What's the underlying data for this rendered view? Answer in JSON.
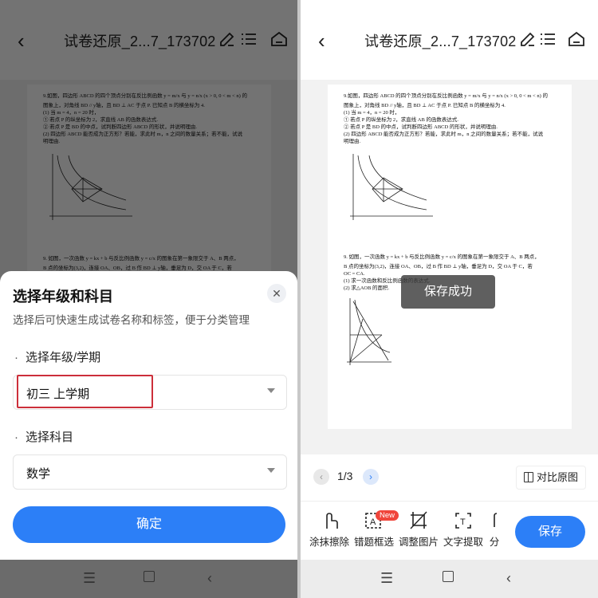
{
  "header": {
    "title": "试卷还原_2...7_173702",
    "back_icon": "chevron-left-icon",
    "edit_icon": "pencil-icon",
    "list_icon": "list-icon",
    "home_icon": "home-icon"
  },
  "paper": {
    "q9_line1": "9.如图，四边形 ABCD 的四个顶点分别在反比例函数 y = m/x 与 y = n/x (x > 0, 0 < m < n) 的",
    "q9_line2": "图象上，对角线 BD // y轴，且 BD ⊥ AC 于点 P. 已知点 B 的横坐标为 4.",
    "q9_line3": "(1) 当 m = 4，n = 20 时，",
    "q9_line4": "① 若点 P 的纵坐标为 2，求直线 AB 的函数表达式.",
    "q9_line5": "② 若点 P 是 BD 的中点，试判断四边形 ABCD 的形状，并说明理由.",
    "q9_line6": "(2) 四边形 ABCD 能否成为正方形？若能，求此时 m，n 之间的数量关系；若不能，试说",
    "q9_line7": "明理由.",
    "q9b_line1": "9.   如图，一次函数 y = kx + b 与反比例函数 y = c/x 的图象在第一象限交于 A、B 两点，",
    "q9b_line2": "B 点的坐标为(3,2)，连接 OA、OB，过 B 作 BD ⊥ y轴，垂足为 D，交 OA 于 C，若",
    "q9b_line3": "OC = CA.",
    "q9b_line4": "(1) 求一次函数和反比例函数的表达式.",
    "q9b_line5": "(2) 求△AOB 的面积."
  },
  "sheet": {
    "title": "选择年级和科目",
    "subtitle": "选择后可快速生成试卷名称和标签，便于分类管理",
    "grade_label": "选择年级/学期",
    "grade_value": "初三  上学期",
    "subject_label": "选择科目",
    "subject_value": "数学",
    "confirm_label": "确定",
    "bullet": "·"
  },
  "right": {
    "toast": "保存成功",
    "page_indicator": "1/3",
    "compare_label": "对比原图",
    "tools": [
      {
        "label": "涂抹擦除",
        "icon": "hand-pointer-icon"
      },
      {
        "label": "错题框选",
        "icon": "select-box-icon"
      },
      {
        "label": "调整图片",
        "icon": "crop-icon"
      },
      {
        "label": "文字提取",
        "icon": "text-extract-icon"
      },
      {
        "label": "分",
        "icon": "split-icon"
      }
    ],
    "new_badge": "New",
    "save_label": "保存"
  },
  "navbar": {
    "menu_icon": "menu-icon",
    "home_icon": "square-home-icon",
    "back_icon": "triangle-back-icon"
  }
}
